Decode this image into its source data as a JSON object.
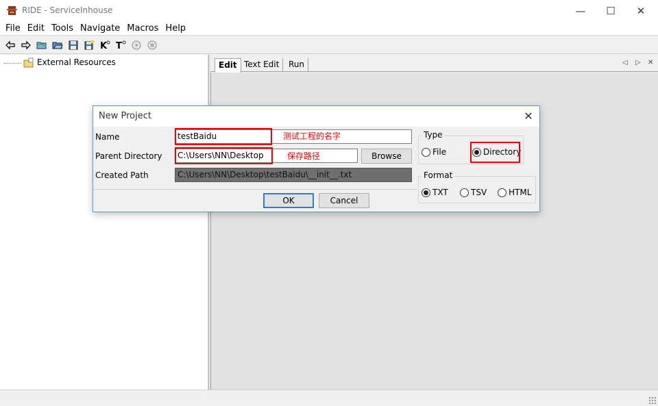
{
  "window": {
    "title": "RIDE - ServiceInhouse",
    "minimize": "—",
    "maximize": "☐",
    "close": "✕"
  },
  "menu": [
    "File",
    "Edit",
    "Tools",
    "Navigate",
    "Macros",
    "Help"
  ],
  "toolbar": [
    "back-icon",
    "forward-icon",
    "open-suite-icon",
    "open-directory-icon",
    "save-icon",
    "save-all-icon",
    "search-keywords-icon",
    "search-tests-icon",
    "run-icon",
    "stop-icon"
  ],
  "toolbar_glyphs": {
    "search_keywords": "K",
    "search_tests": "T"
  },
  "tree": {
    "external_resources": "External Resources"
  },
  "tabs": [
    "Edit",
    "Text Edit",
    "Run"
  ],
  "tab_arrows": {
    "left": "◁",
    "right": "▷",
    "close": "✕"
  },
  "dialog": {
    "title": "New Project",
    "close": "✕",
    "name_label": "Name",
    "name_value": "testBaidu",
    "name_note": "测试工程的名字",
    "parent_label": "Parent Directory",
    "parent_value": "C:\\Users\\NN\\Desktop",
    "parent_note": "保存路径",
    "browse": "Browse",
    "created_label": "Created Path",
    "created_value": "C:\\Users\\NN\\Desktop\\testBaidu\\__init__.txt",
    "type_title": "Type",
    "type_options": {
      "file": "File",
      "directory": "Directory"
    },
    "type_selected": "Directory",
    "format_title": "Format",
    "format_options": {
      "txt": "TXT",
      "tsv": "TSV",
      "html": "HTML"
    },
    "format_selected": "TXT",
    "ok": "OK",
    "cancel": "Cancel"
  },
  "colors": {
    "annotation_red": "#ee0000",
    "dialog_border": "#5a9bd5",
    "default_button": "#2c7bd6"
  }
}
